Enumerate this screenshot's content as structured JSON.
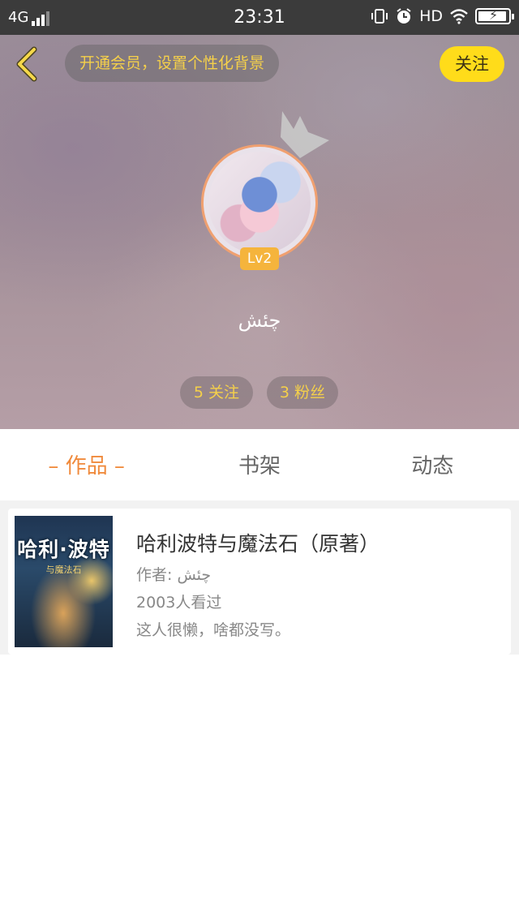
{
  "status_bar": {
    "network": "4G",
    "time": "23:31",
    "hd": "HD"
  },
  "header": {
    "vip_prompt": "开通会员，设置个性化背景",
    "follow_label": "关注"
  },
  "profile": {
    "level": "Lv2",
    "nickname": "چئش",
    "following": "5 关注",
    "fans": "3 粉丝"
  },
  "tabs": [
    {
      "label": "– 作品 –",
      "active": true
    },
    {
      "label": "书架",
      "active": false
    },
    {
      "label": "动态",
      "active": false
    }
  ],
  "works": [
    {
      "cover_title": "哈利·波特",
      "cover_subtitle": "与魔法石",
      "title": "哈利波特与魔法石（原著）",
      "author": "作者: چئش",
      "views": "2003人看过",
      "description": "这人很懒，啥都没写。"
    }
  ],
  "colors": {
    "accent": "#f08a3c",
    "follow_button": "#ffdc1a",
    "pill_text": "#f5d04a",
    "level_badge": "#f5b43c"
  },
  "icons": [
    "back-arrow-icon",
    "crown-icon",
    "vibrate-icon",
    "alarm-icon",
    "wifi-icon",
    "battery-icon",
    "signal-icon"
  ]
}
